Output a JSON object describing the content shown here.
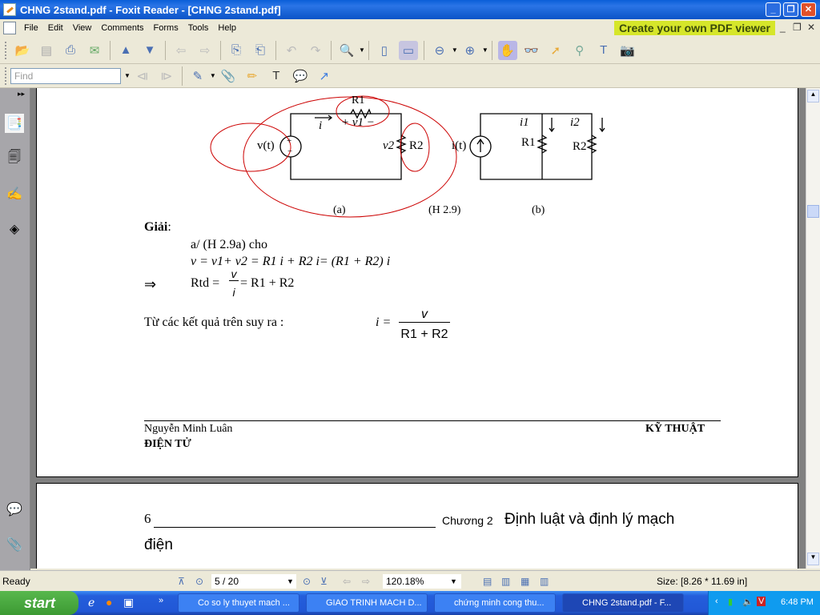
{
  "window": {
    "title": "CHNG 2stand.pdf - Foxit Reader - [CHNG 2stand.pdf]"
  },
  "menu": [
    "File",
    "Edit",
    "View",
    "Comments",
    "Forms",
    "Tools",
    "Help"
  ],
  "promo": "Create your own PDF viewer",
  "find": {
    "placeholder": "Find"
  },
  "page1": {
    "figure": {
      "r1": "R1",
      "v1": "+ v1 −",
      "i": "i",
      "vt": "v(t)",
      "v2": "v2",
      "r2": "R2",
      "it": "i(t)",
      "i1": "i1",
      "i2": "i2",
      "r1b": "R1",
      "r2b": "R2",
      "cap_a": "(a)",
      "cap": "(H 2.9)",
      "cap_b": "(b)"
    },
    "giai": "Giải",
    "line1": "a/ (H 2.9a) cho",
    "line2": "v = v1+ v2 = R1 i + R2 i= (R1 + R2) i",
    "arrow": "⇒",
    "rtd": "Rtd =",
    "frac_num": "v",
    "frac_den": "i",
    "rtd_rest": "= R1 + R2",
    "conclusion": "Từ các kết quả trên suy ra :",
    "final_lhs": "i =",
    "final_num": "v",
    "final_den": "R1 + R2",
    "footer_author": "Nguyễn Minh Luân",
    "footer_right": "KỸ THUẬT",
    "footer_left2": "ĐIỆN TỬ"
  },
  "page2": {
    "page_num": "6",
    "chapter_small": "Chương 2",
    "chapter_title": "Định luật và định lý mạch",
    "chapter_cont": "điện"
  },
  "status": {
    "ready": "Ready",
    "page": "5 / 20",
    "zoom": "120.18%",
    "size": "Size: [8.26 * 11.69 in]"
  },
  "taskbar": {
    "start": "start",
    "tasks": [
      "Co so ly thuyet mach ...",
      "GIAO TRINH MACH D...",
      "chứng minh cong thu...",
      "CHNG 2stand.pdf - F..."
    ],
    "clock": "6:48 PM"
  }
}
